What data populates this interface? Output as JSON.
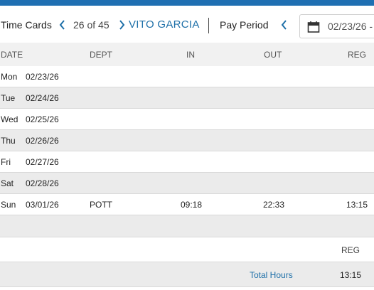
{
  "header": {
    "title": "Time Cards",
    "counter": "26 of 45",
    "employee_name": "VITO GARCIA",
    "pay_period_label": "Pay Period",
    "pay_period_date": "02/23/26 -"
  },
  "grid": {
    "columns": [
      "DATE",
      "DEPT",
      "IN",
      "OUT",
      "REG"
    ],
    "rows": [
      {
        "day": "Mon",
        "date": "02/23/26",
        "dept": "",
        "in": "",
        "out": "",
        "reg": ""
      },
      {
        "day": "Tue",
        "date": "02/24/26",
        "dept": "",
        "in": "",
        "out": "",
        "reg": ""
      },
      {
        "day": "Wed",
        "date": "02/25/26",
        "dept": "",
        "in": "",
        "out": "",
        "reg": ""
      },
      {
        "day": "Thu",
        "date": "02/26/26",
        "dept": "",
        "in": "",
        "out": "",
        "reg": ""
      },
      {
        "day": "Fri",
        "date": "02/27/26",
        "dept": "",
        "in": "",
        "out": "",
        "reg": ""
      },
      {
        "day": "Sat",
        "date": "02/28/26",
        "dept": "",
        "in": "",
        "out": "",
        "reg": ""
      },
      {
        "day": "Sun",
        "date": "03/01/26",
        "dept": "POTT",
        "in": "09:18",
        "out": "22:33",
        "reg": "13:15"
      }
    ]
  },
  "summary": {
    "column": "REG",
    "total_label": "Total Hours",
    "total_value": "13:15"
  },
  "icons": {
    "prev": "chevron-left-icon",
    "next": "chevron-right-icon",
    "calendar": "calendar-icon"
  },
  "colors": {
    "accent": "#1f6fb2",
    "link": "#1d6fa8",
    "row_alt": "#ebebeb"
  }
}
